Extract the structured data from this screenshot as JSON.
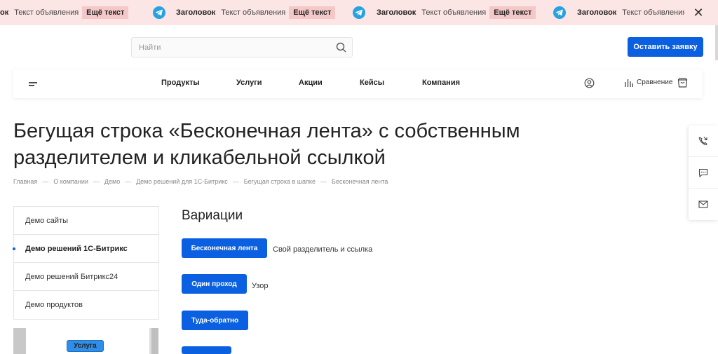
{
  "marquee": {
    "items": [
      {
        "title": "",
        "text": "Текст объявления",
        "button": "Ещё текст",
        "partial_title": "ок"
      },
      {
        "title": "Заголовок",
        "text": "Текст объявления",
        "button": "Ещё текст"
      },
      {
        "title": "Заголовок",
        "text": "Текст объявления",
        "button": "Ещё текст"
      },
      {
        "title": "Заголовок",
        "text": "Текст объявления",
        "button": ""
      }
    ],
    "close": "✕"
  },
  "header": {
    "search_placeholder": "Найти",
    "cta_label": "Оставить заявку"
  },
  "nav": {
    "links": [
      "Продукты",
      "Услуги",
      "Акции",
      "Кейсы",
      "Компания"
    ],
    "compare_label": "Сравнение"
  },
  "page": {
    "title": "Бегущая строка «Бесконечная лента» с собственным разделителем и кликабельной ссылкой",
    "breadcrumb": [
      "Главная",
      "О компании",
      "Демо",
      "Демо решений для 1С-Битрикс",
      "Бегущая строка в шапке",
      "Бесконечная лента"
    ]
  },
  "side_menu": {
    "items": [
      {
        "label": "Демо сайты",
        "active": false
      },
      {
        "label": "Демо решений 1С-Битрикс",
        "active": true
      },
      {
        "label": "Демо решений Битрикс24",
        "active": false
      },
      {
        "label": "Демо продуктов",
        "active": false
      }
    ],
    "banner_badge": "Услуга"
  },
  "variations": {
    "title": "Вариации",
    "items": [
      {
        "button": "Бесконечная лента",
        "text": "Свой разделитель и ссылка"
      },
      {
        "button": "Один проход",
        "text": "Узор"
      },
      {
        "button": "Туда-обратно",
        "text": ""
      }
    ]
  },
  "colors": {
    "accent": "#0a60e0",
    "marquee_bg": "#fbe5e5",
    "marquee_button_bg": "#f4c8c8",
    "telegram": "#27a2e0"
  }
}
